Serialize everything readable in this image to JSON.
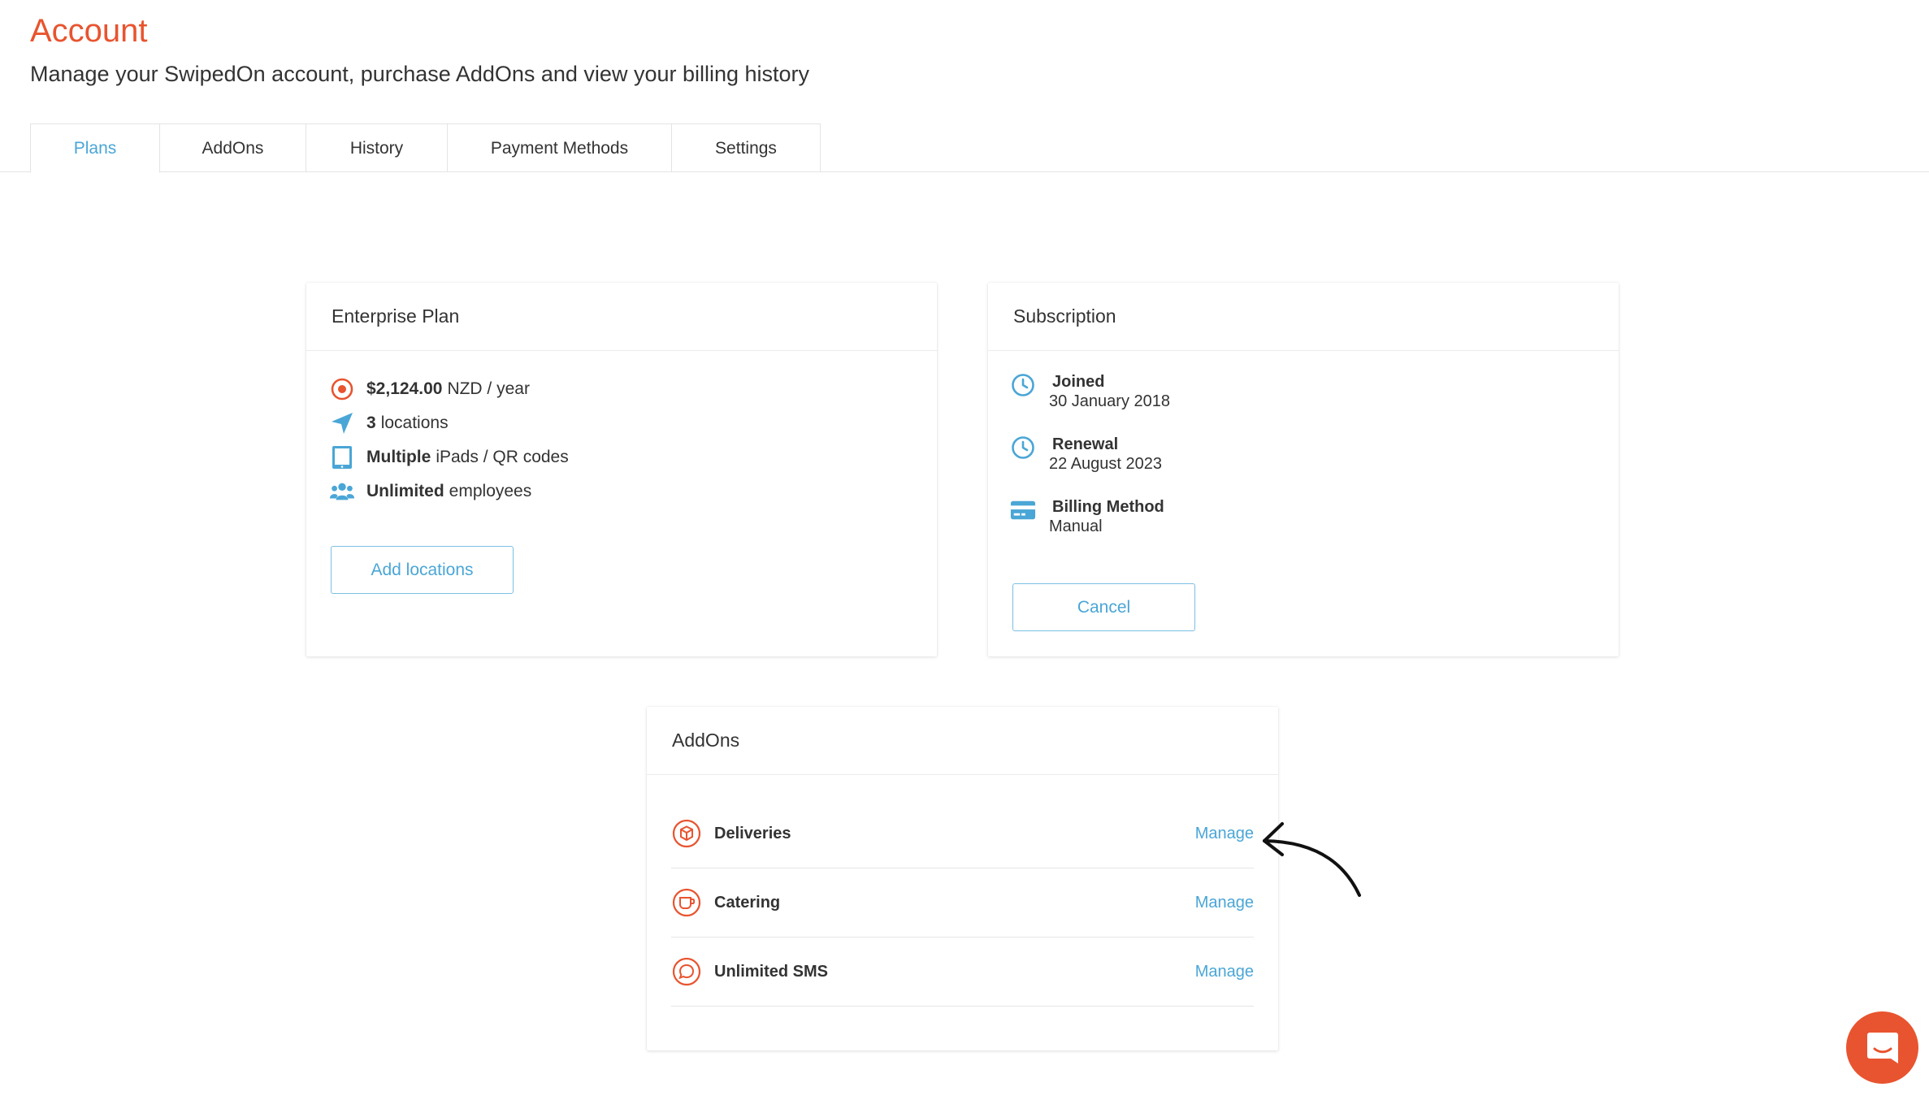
{
  "page": {
    "title": "Account",
    "subtitle": "Manage your SwipedOn account, purchase AddOns and view your billing history"
  },
  "tabs": [
    {
      "label": "Plans",
      "active": true
    },
    {
      "label": "AddOns"
    },
    {
      "label": "History"
    },
    {
      "label": "Payment Methods"
    },
    {
      "label": "Settings"
    }
  ],
  "plan": {
    "title": "Enterprise Plan",
    "price_bold": "$2,124.00",
    "price_rest": "NZD / year",
    "locations_bold": "3",
    "locations_rest": "locations",
    "devices_bold": "Multiple",
    "devices_rest": "iPads / QR codes",
    "employees_bold": "Unlimited",
    "employees_rest": "employees",
    "add_button": "Add locations"
  },
  "subscription": {
    "title": "Subscription",
    "joined_label": "Joined",
    "joined_value": "30 January 2018",
    "renewal_label": "Renewal",
    "renewal_value": "22 August 2023",
    "billing_label": "Billing Method",
    "billing_value": "Manual",
    "cancel_button": "Cancel"
  },
  "addons": {
    "title": "AddOns",
    "items": [
      {
        "name": "Deliveries",
        "action": "Manage"
      },
      {
        "name": "Catering",
        "action": "Manage"
      },
      {
        "name": "Unlimited SMS",
        "action": "Manage"
      }
    ]
  },
  "colors": {
    "accent": "#e8542f",
    "link": "#4aa6d6"
  }
}
